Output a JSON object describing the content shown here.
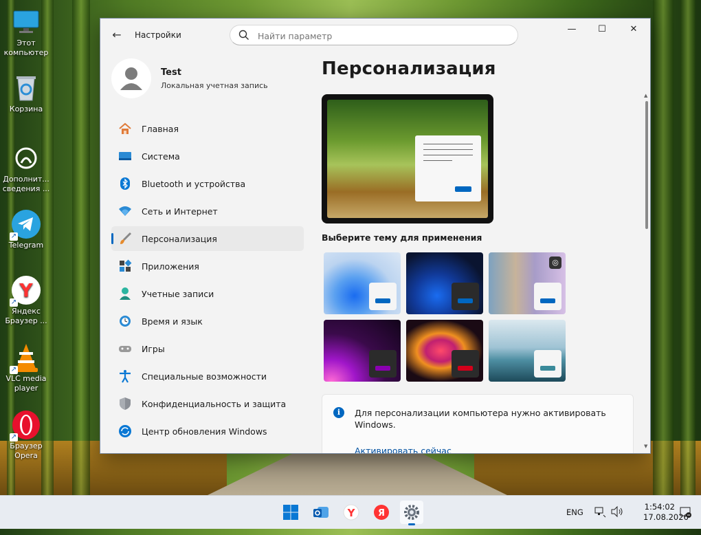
{
  "desktop": {
    "icons": [
      {
        "label": "Этот компьютер",
        "icon": "monitor-icon"
      },
      {
        "label": "Корзина",
        "icon": "recycle-bin-icon"
      },
      {
        "label": "Дополнит... сведения ...",
        "icon": "info-icon"
      },
      {
        "label": "Telegram",
        "icon": "telegram-icon"
      },
      {
        "label": "Яндекс Браузер ...",
        "icon": "yandex-browser-icon"
      },
      {
        "label": "VLC media player",
        "icon": "vlc-icon"
      },
      {
        "label": "Браузер Opera",
        "icon": "opera-icon"
      }
    ]
  },
  "window": {
    "app_title": "Настройки",
    "search_placeholder": "Найти параметр",
    "controls": {
      "minimize": "—",
      "maximize": "☐",
      "close": "✕"
    },
    "user": {
      "name": "Test",
      "account_type": "Локальная учетная запись"
    },
    "nav": [
      {
        "label": "Главная",
        "icon": "home-icon",
        "active": false
      },
      {
        "label": "Система",
        "icon": "system-icon",
        "active": false
      },
      {
        "label": "Bluetooth и устройства",
        "icon": "bluetooth-icon",
        "active": false
      },
      {
        "label": "Сеть и Интернет",
        "icon": "wifi-icon",
        "active": false
      },
      {
        "label": "Персонализация",
        "icon": "brush-icon",
        "active": true
      },
      {
        "label": "Приложения",
        "icon": "apps-icon",
        "active": false
      },
      {
        "label": "Учетные записи",
        "icon": "accounts-icon",
        "active": false
      },
      {
        "label": "Время и язык",
        "icon": "time-language-icon",
        "active": false
      },
      {
        "label": "Игры",
        "icon": "gamepad-icon",
        "active": false
      },
      {
        "label": "Специальные возможности",
        "icon": "accessibility-icon",
        "active": false
      },
      {
        "label": "Конфиденциальность и защита",
        "icon": "shield-icon",
        "active": false
      },
      {
        "label": "Центр обновления Windows",
        "icon": "update-icon",
        "active": false
      }
    ],
    "content": {
      "title": "Персонализация",
      "themes_title": "Выберите тему для применения",
      "themes": [
        {
          "name": "light-bloom",
          "bg": "#bcd4f0",
          "card": "#f5f5f5",
          "accent": "#0067c0"
        },
        {
          "name": "dark-bloom",
          "bg": "#0a1430",
          "card": "#2b2b2b",
          "accent": "#0067c0"
        },
        {
          "name": "spotlight",
          "bg": "#c9b7a5",
          "card": "#f5f5f5",
          "accent": "#0067c0"
        },
        {
          "name": "glow",
          "bg": "#2a0a30",
          "card": "#2b2b2b",
          "accent": "#8a00b0"
        },
        {
          "name": "captured-motion",
          "bg": "#1a0a14",
          "card": "#2b2b2b",
          "accent": "#d4001a"
        },
        {
          "name": "flow",
          "bg": "#8fb6c8",
          "card": "#f5f5f5",
          "accent": "#3a8a9a"
        }
      ],
      "activation_message": "Для персонализации компьютера нужно активировать Windows.",
      "activation_link": "Активировать сейчас"
    }
  },
  "taskbar": {
    "apps": [
      "windows-start-icon",
      "outlook-icon",
      "yandex-browser-icon",
      "yandex-icon",
      "settings-icon"
    ],
    "language": "ENG",
    "time": "1:54:02",
    "date": "17.08.2026"
  },
  "colors": {
    "accent": "#0067c0",
    "window_bg": "#f3f3f3",
    "taskbar_bg": "#e8ecf2"
  }
}
